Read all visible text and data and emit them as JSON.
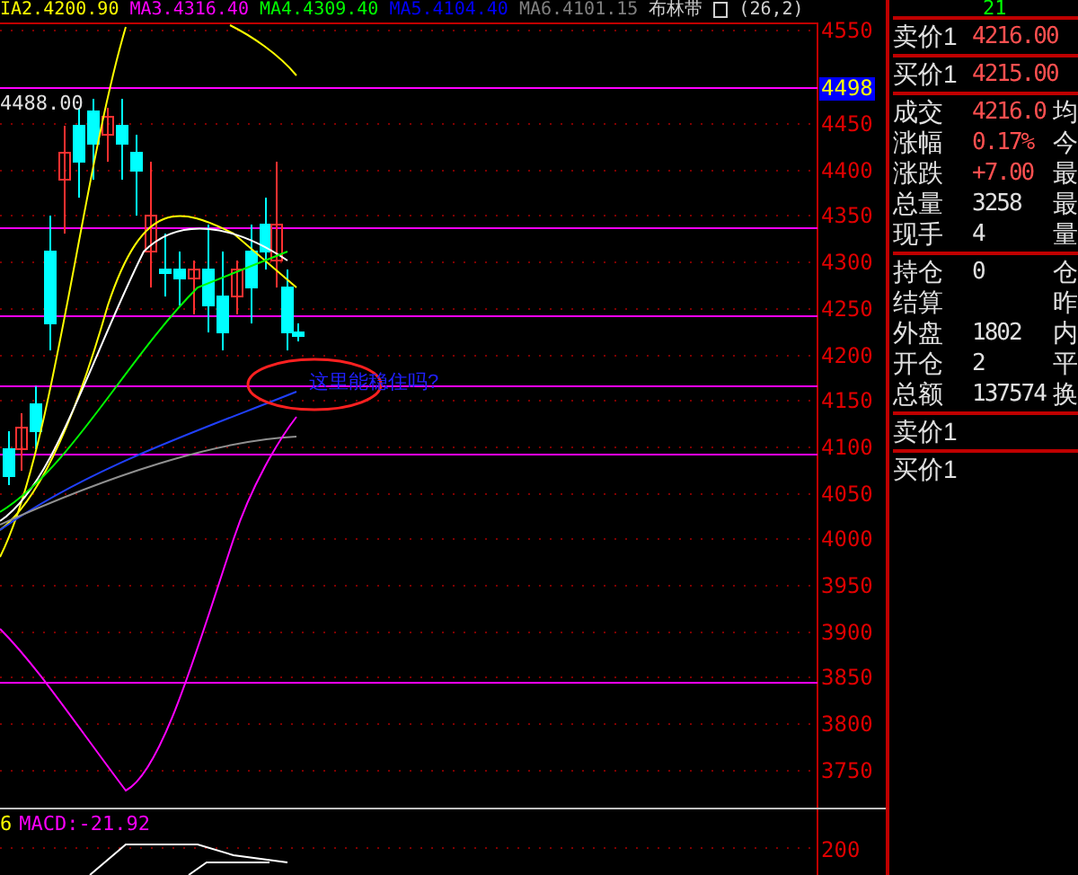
{
  "indicator_bar": {
    "items": [
      {
        "text": "IA2.4200.90",
        "color": "#ffff00"
      },
      {
        "text": "MA3.4316.40",
        "color": "#ff00ff"
      },
      {
        "text": "MA4.4309.40",
        "color": "#00ff00"
      },
      {
        "text": "MA5.4104.40",
        "color": "#0000ff"
      },
      {
        "text": "MA6.4101.15",
        "color": "#808080"
      }
    ],
    "bollinger": "布林带",
    "params": "(26,2)"
  },
  "price_axis": {
    "labels": [
      "4550",
      "4450",
      "4400",
      "4350",
      "4300",
      "4250",
      "4200",
      "4150",
      "4100",
      "4050",
      "4000",
      "3950",
      "3900",
      "3850",
      "3800",
      "3750"
    ],
    "current_price": "4498"
  },
  "chart_label": "4488.00",
  "annotation": "这里能稳住吗?",
  "macd": {
    "prefix": "6",
    "label": "MACD:-21.92",
    "axis_label": "200"
  },
  "quote_panel": {
    "top_value": "21",
    "sections": [
      {
        "rows": [
          {
            "label": "卖价1",
            "value": "4216.00",
            "color": "#ff5050"
          }
        ]
      },
      {
        "rows": [
          {
            "label": "买价1",
            "value": "4215.00",
            "color": "#ff5050"
          }
        ]
      },
      {
        "rows": [
          {
            "label": "成交",
            "value": "4216.0",
            "color": "#ff5050",
            "side": "均"
          },
          {
            "label": "涨幅",
            "value": "0.17%",
            "color": "#ff5050",
            "side": "今"
          },
          {
            "label": "涨跌",
            "value": "+7.00",
            "color": "#ff5050",
            "side": "最"
          },
          {
            "label": "总量",
            "value": "3258",
            "color": "#e0e0e0",
            "side": "最"
          },
          {
            "label": "现手",
            "value": "4",
            "color": "#e0e0e0",
            "side": "量"
          }
        ]
      },
      {
        "rows": [
          {
            "label": "持仓",
            "value": "0",
            "color": "#e0e0e0",
            "side": "仓"
          },
          {
            "label": "结算",
            "side": "昨"
          },
          {
            "label": "外盘",
            "value": "1802",
            "color": "#e0e0e0",
            "side": "内"
          },
          {
            "label": "开仓",
            "value": "2",
            "color": "#e0e0e0",
            "side": "平"
          },
          {
            "label": "总额",
            "value": "137574",
            "color": "#e0e0e0",
            "side": "换"
          }
        ]
      },
      {
        "rows": [
          {
            "label": "卖价1"
          }
        ]
      },
      {
        "rows": [
          {
            "label": "买价1"
          }
        ]
      }
    ]
  }
}
